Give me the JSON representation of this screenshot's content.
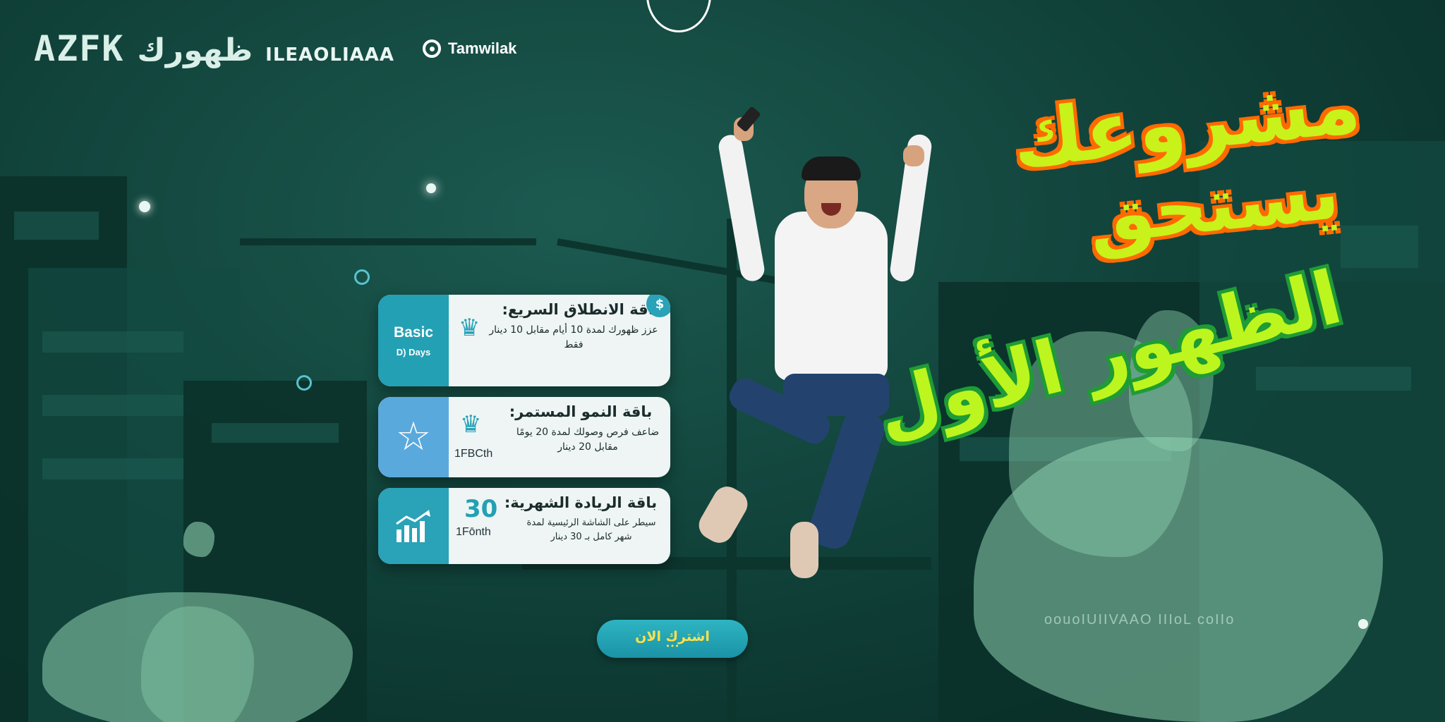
{
  "brand": {
    "logo_main": "AZFK",
    "logo_arabic": "ظهورك",
    "logo_latin": "ILEAOLIAAA",
    "partner_name": "Tamwilak"
  },
  "headline": {
    "line1": "مشروعك",
    "line2": "يستحق",
    "line3": "الظهور الأول"
  },
  "packages": [
    {
      "title": "باقة الانطلاق السريع:",
      "description": "عزز ظهورك لمدة 10 أيام مقابل 10 دينار فقط",
      "side_label": "Basic",
      "side_sub": "D) Days",
      "icon": "crown-icon",
      "coin": "$"
    },
    {
      "title": "باقة النمو المستمر:",
      "description": "ضاعف فرص وصولك لمدة 20 يومًا مقابل 20 دينار",
      "side_icon": "star-icon",
      "badge_sub": "1FBCth",
      "icon": "crown-icon"
    },
    {
      "title": "باقة الريادة الشهرية:",
      "description": "سيطر على الشاشة الرئيسية لمدة شهر كامل بـ 30 دينار",
      "side_icon": "growth-chart-icon",
      "badge_big": "30",
      "badge_sub": "1Fōnth"
    }
  ],
  "cta": {
    "label": "اشترك الان",
    "dots": "•••"
  },
  "background_text": "oouoIUIIVAAO IIIoL coIIo",
  "colors": {
    "background": "#0f3f37",
    "headline_fill": "#c8f21a",
    "headline_outline_orange": "#ff6a00",
    "headline_outline_green": "#1e9c35",
    "accent_teal": "#2aa2b8",
    "cta_text": "#ffe14a"
  }
}
